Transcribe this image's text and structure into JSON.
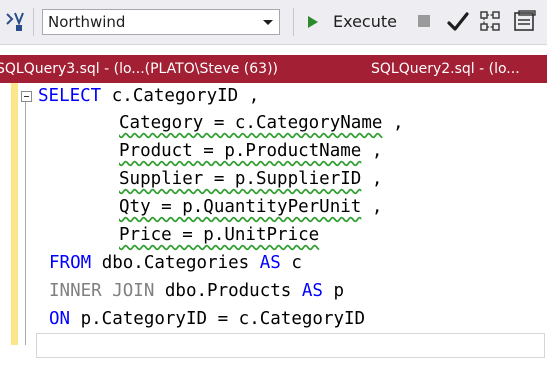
{
  "toolbar": {
    "database": "Northwind",
    "execute_label": "Execute",
    "icons": [
      "toolbar-left-icon",
      "play-icon",
      "stop-icon",
      "checkmark-icon",
      "query-plan-icon",
      "results-pane-icon"
    ]
  },
  "tabs": [
    {
      "label": "SQLQuery3.sql - (lo...(PLATO\\Steve (63))"
    },
    {
      "label": "SQLQuery2.sql - (lo..."
    }
  ],
  "editor": {
    "lines": [
      {
        "kw": "SELECT",
        "text": " c.CategoryID ,"
      },
      {
        "text": "Category = c.CategoryName",
        "tail": " ,"
      },
      {
        "text": "Product = p.ProductName",
        "tail": " ,"
      },
      {
        "text": "Supplier = p.SupplierID",
        "tail": " ,"
      },
      {
        "text": "Qty = p.QuantityPerUnit",
        "tail": " ,"
      },
      {
        "text": "Price = p.UnitPrice"
      },
      {
        "kw": "FROM",
        "text": " dbo.Categories ",
        "kw2": "AS",
        "tail": " c"
      },
      {
        "gray": "INNER JOIN",
        "text": " dbo.Products ",
        "kw2": "AS",
        "tail": " p"
      },
      {
        "kw": "ON",
        "text": " p.CategoryID = c.CategoryID"
      }
    ]
  },
  "colors": {
    "tab_active_bg": "#a31f34",
    "keyword": "#0000ff",
    "gray_keyword": "#808080",
    "squiggle": "#2e9e2e",
    "margin_bar": "#fbe78a"
  }
}
